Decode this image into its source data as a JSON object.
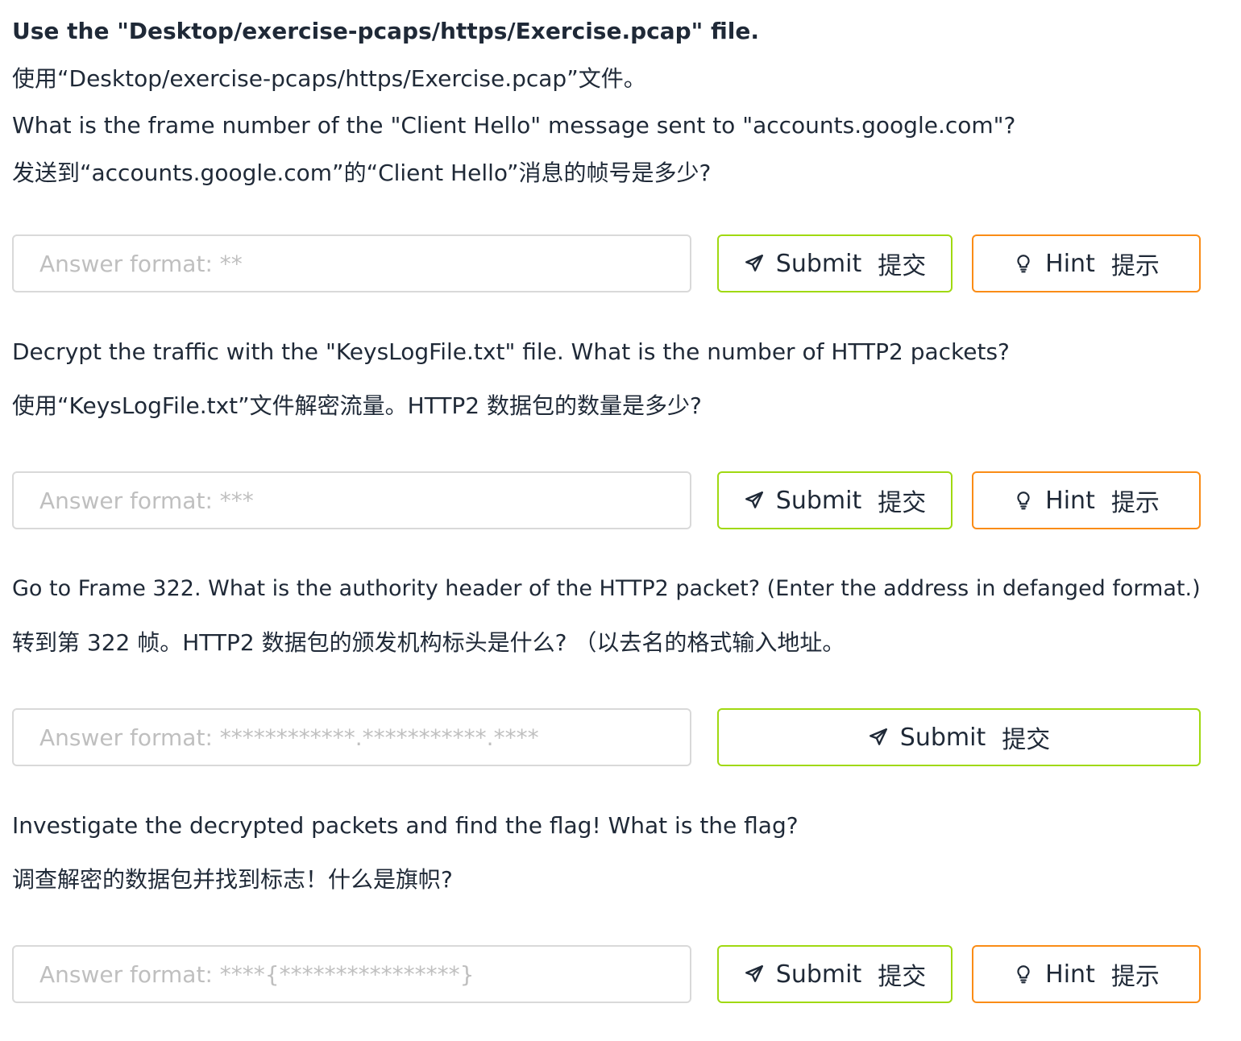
{
  "intro": {
    "en": "Use the \"Desktop/exercise-pcaps/https/Exercise.pcap\" file.",
    "cn": "使用“Desktop/exercise-pcaps/https/Exercise.pcap”文件。"
  },
  "buttons": {
    "submit_en": "Submit",
    "submit_cn": "提交",
    "hint_en": "Hint",
    "hint_cn": "提示"
  },
  "questions": [
    {
      "en": "What is the frame number of the \"Client Hello\" message sent to \"accounts.google.com\"?",
      "cn": "发送到“accounts.google.com”的“Client Hello”消息的帧号是多少?",
      "placeholder": "Answer format: **",
      "has_hint": true
    },
    {
      "en": "Decrypt the traffic with the \"KeysLogFile.txt\" file. What is the number of HTTP2 packets?",
      "cn": "使用“KeysLogFile.txt”文件解密流量。HTTP2 数据包的数量是多少?",
      "placeholder": "Answer format: ***",
      "has_hint": true
    },
    {
      "en": "Go to Frame 322. What is the authority header of the HTTP2 packet? (Enter the address in defanged format.)",
      "cn": "转到第 322 帧。HTTP2 数据包的颁发机构标头是什么? （以去名的格式输入地址。",
      "placeholder": "Answer format: ************.***********.****",
      "has_hint": false
    },
    {
      "en": "Investigate the decrypted packets and find the flag! What is the flag?",
      "cn": "调查解密的数据包并找到标志！什么是旗帜?",
      "placeholder": "Answer format: ****{****************}",
      "has_hint": true
    }
  ],
  "colors": {
    "submit_border": "#a0d911",
    "hint_border": "#fa8c16",
    "input_border": "#d9d9d9",
    "placeholder": "#bfbfbf",
    "text": "#1f2937"
  },
  "icons": {
    "submit": "send-icon",
    "hint": "bulb-icon"
  }
}
